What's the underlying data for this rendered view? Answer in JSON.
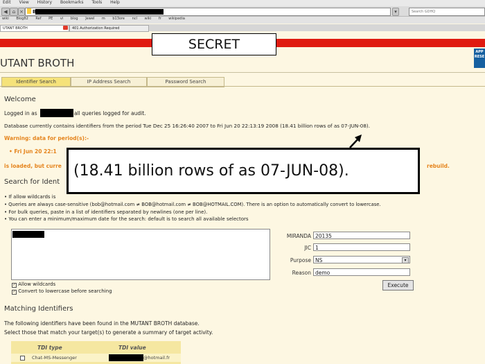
{
  "browser": {
    "menu": [
      "Edit",
      "View",
      "History",
      "Bookmarks",
      "Tools",
      "Help"
    ],
    "url_prefix": "B",
    "search_placeholder": "Search GDHQ",
    "bookmarks": [
      "wiki",
      "Blog82",
      "Ref",
      "PE",
      "vi",
      "blog",
      "Jewel",
      "m",
      "b13ore",
      "ncl",
      "wiki",
      "fr",
      "wikipedia"
    ],
    "tabs": [
      "UTANT BROTH",
      "401 Authorization Required"
    ]
  },
  "banner": {
    "classification": "SECRET",
    "logo_lines": [
      "APP",
      "RESE"
    ]
  },
  "app": {
    "title": "UTANT BROTH",
    "tabs": [
      "Identifier Search",
      "IP Address Search",
      "Password Search"
    ],
    "active_tab": 0
  },
  "welcome": {
    "heading": "Welcome",
    "logged_in_prefix": "Logged in as",
    "logged_in_suffix": "all queries logged for audit.",
    "db_line": "Database currently contains identifiers from the period Tue Dec 25 16:26:40 2007 to Fri Jun 20 22:13:19 2008 (18.41 billion rows of as 07-JUN-08).",
    "warning": "Warning: data for period(s):-",
    "warning_item": "• Fri Jun 20 22:1",
    "loaded_prefix": "is loaded, but curre",
    "loaded_suffix": "rebuild."
  },
  "callout": {
    "text": "(18.41 billion rows of as 07-JUN-08)."
  },
  "search": {
    "heading": "Search for Ident",
    "bullets": [
      "• If allow wildcards is",
      "• Queries are always case-sensitive (bob@hotmail.com ≠ BOB@hotmail.com ≠ BOB@HOTMAIL.COM). There is an option to automatically convert to lowercase.",
      "• For bulk queries, paste in a list of identifiers separated by newlines (one per line).",
      "• You can enter a minimum/maximum date for the search: default is to search all available selectors"
    ]
  },
  "form": {
    "fields": [
      {
        "label": "MIRANDA",
        "value": "20135"
      },
      {
        "label": "JIC",
        "value": "1"
      },
      {
        "label": "Purpose",
        "value": "NS"
      },
      {
        "label": "Reason",
        "value": "demo"
      }
    ],
    "execute_label": "Execute",
    "allow_wildcards": "Allow wildcards",
    "lowercase": "Convert to lowercase before searching"
  },
  "results": {
    "heading": "Matching Identifiers",
    "line1": "The following identifiers have been found in the MUTANT BROTH database.",
    "line2": "Select those that match your target(s) to generate a summary of target activity.",
    "columns": [
      "TDI type",
      "TDI value"
    ],
    "rows": [
      {
        "type": "Chat-MS-Messenger",
        "value_suffix": "@hotmail.fr"
      }
    ]
  }
}
